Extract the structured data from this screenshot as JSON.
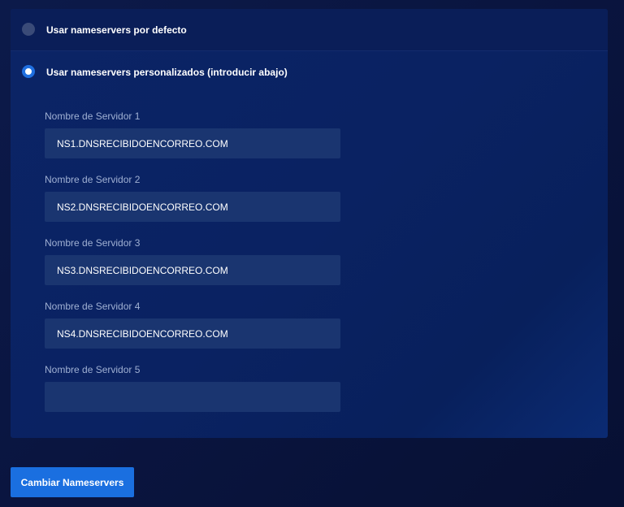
{
  "options": {
    "default": {
      "label": "Usar nameservers por defecto",
      "selected": false
    },
    "custom": {
      "label": "Usar nameservers personalizados (introducir abajo)",
      "selected": true
    }
  },
  "fields": [
    {
      "label": "Nombre de Servidor 1",
      "value": "NS1.DNSRECIBIDOENCORREO.COM"
    },
    {
      "label": "Nombre de Servidor 2",
      "value": "NS2.DNSRECIBIDOENCORREO.COM"
    },
    {
      "label": "Nombre de Servidor 3",
      "value": "NS3.DNSRECIBIDOENCORREO.COM"
    },
    {
      "label": "Nombre de Servidor 4",
      "value": "NS4.DNSRECIBIDOENCORREO.COM"
    },
    {
      "label": "Nombre de Servidor 5",
      "value": ""
    }
  ],
  "submit": {
    "label": "Cambiar Nameservers"
  },
  "colors": {
    "accent": "#1a6fe0",
    "panel": "#0b2466",
    "input": "#1a3570",
    "label": "#9fb0d3"
  }
}
